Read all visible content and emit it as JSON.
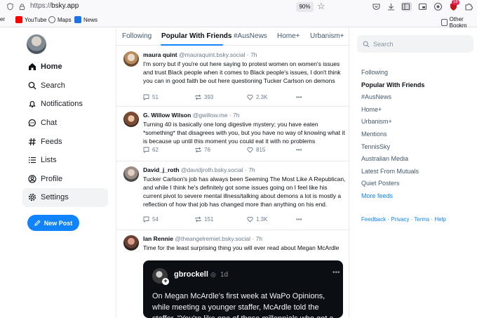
{
  "browser": {
    "url_scheme": "https://",
    "url_host": "bsky.app",
    "zoom": "90%",
    "extension_badge": "16",
    "bookmarks": [
      {
        "label": "YouTube",
        "color": "#ff0000"
      },
      {
        "label": "Maps",
        "color": "#34a853"
      },
      {
        "label": "News",
        "color": "#1a73e8"
      }
    ],
    "bookmarks_truncated_left": "er",
    "other_bookmarks": "Other Bookm"
  },
  "nav": {
    "items": [
      {
        "label": "Home",
        "icon": "home-icon"
      },
      {
        "label": "Search",
        "icon": "search-icon"
      },
      {
        "label": "Notifications",
        "icon": "bell-icon"
      },
      {
        "label": "Chat",
        "icon": "chat-icon"
      },
      {
        "label": "Feeds",
        "icon": "hash-icon"
      },
      {
        "label": "Lists",
        "icon": "list-icon"
      },
      {
        "label": "Profile",
        "icon": "profile-icon"
      },
      {
        "label": "Settings",
        "icon": "gear-icon"
      }
    ],
    "new_post": "New Post"
  },
  "tabs": [
    "Following",
    "Popular With Friends",
    "#AusNews",
    "Home+",
    "Urbanism+"
  ],
  "posts": [
    {
      "name": "maura quint",
      "handle": "@mauraquint.bsky.social",
      "time": "· 7h",
      "text": "I'm sorry but if you're out here saying to protest women on women's issues and trust Black people when it comes to Black people's issues, I don't think you can in good faith be out here questioning Tucker Carlson on demons",
      "replies": "51",
      "reposts": "393",
      "likes": "2.3K"
    },
    {
      "name": "G. Willow Wilson",
      "handle": "@gwillow.me",
      "time": "· 7h",
      "text": "Turning 40 is basically one long digestive mystery; you have eaten *something* that disagrees with you, but you have no way of knowing what it is because up until this moment you could eat it with no problems",
      "replies": "62",
      "reposts": "76",
      "likes": "815"
    },
    {
      "name": "David_j_roth",
      "handle": "@davidjroth.bsky.social",
      "time": "· 7h",
      "text": "Tucker Carlson's job has always been Seeming The Most Like A Republican, and while I think he's definitely got some issues going on I feel like his current pivot to severe mental illness/talking about demons a lot is mostly a reflection of how that job has changed more than anything on his end.",
      "replies": "54",
      "reposts": "151",
      "likes": "1.3K"
    },
    {
      "name": "Ian Rennie",
      "handle": "@theangelremiel.bsky.social",
      "time": "· 7h",
      "text": "Time for the least surprising thing you will ever read about Megan McArdle",
      "embed": {
        "name": "gbrockell",
        "time": "1d",
        "text": "On Megan McArdle's first week at WaPo Opinions, while meeting a younger staffer, McArdle told the staffer, \"You're like one of those millennials who got a"
      }
    }
  ],
  "right": {
    "search_placeholder": "Search",
    "feeds": [
      "Following",
      "Popular With Friends",
      "#AusNews",
      "Home+",
      "Urbanism+",
      "Mentions",
      "TennisSky",
      "Australian Media",
      "Latest From Mutuals",
      "Quiet Posters"
    ],
    "more_feeds": "More feeds",
    "footer": "Feedback · Privacy · Terms · Help"
  },
  "colors": {
    "accent": "#1083fe",
    "text_muted": "#6b7b8c",
    "embed_bg": "#0b0f14"
  }
}
